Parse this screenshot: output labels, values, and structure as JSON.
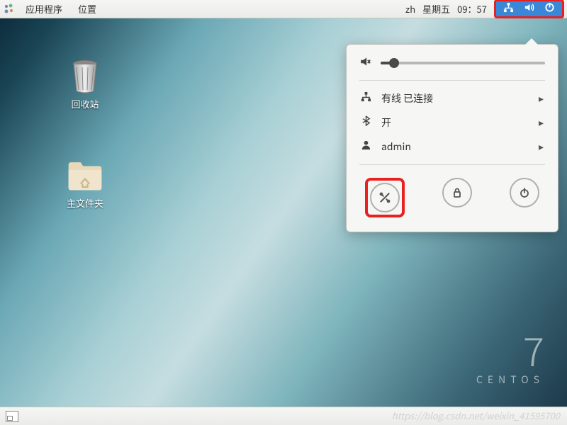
{
  "panel": {
    "applications": "应用程序",
    "places": "位置",
    "locale": "zh",
    "date": "星期五",
    "time": "09：57"
  },
  "desktop": {
    "trash": "回收站",
    "home": "主文件夹"
  },
  "brand": {
    "version": "7",
    "name": "CENTOS"
  },
  "popup": {
    "network": "有线 已连接",
    "bluetooth": "开",
    "user": "admin"
  },
  "watermark": "https://blog.csdn.net/weixin_41595700"
}
